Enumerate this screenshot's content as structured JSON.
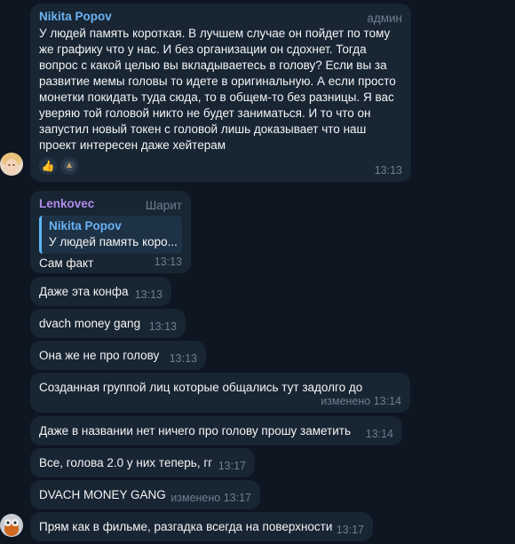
{
  "messages": [
    {
      "author": "Nikita Popov",
      "role": "админ",
      "text": "У людей память короткая. В лучшем случае он пойдет по тому\nже графику что у нас. И без организации он сдохнет. Тогда\nвопрос с какой целью вы вкладываетесь в  голову? Если вы за\nразвитие мемы головы то идете в оригинальную. А если просто\nмонетки покидать туда сюда, то в общем-то без разницы. Я вас\nуверяю той головой никто не будет заниматься. И то что он\nзапустил новый токен с головой лишь доказывает что наш\nпроект интересен даже хейтерам",
      "time": "13:13",
      "reactions": [
        "thumbs-up-emoji",
        "reaction-sticker"
      ]
    },
    {
      "author": "Lenkovec",
      "role": "Шарит",
      "reply": {
        "author": "Nikita Popov",
        "text": "У людей память коро..."
      },
      "text": "Сам факт",
      "time": "13:13"
    },
    {
      "text": "Даже эта конфа",
      "time": "13:13"
    },
    {
      "text": "dvach money gang",
      "time": "13:13"
    },
    {
      "text": "Она же не про голову",
      "time": "13:13"
    },
    {
      "text": "Созданная группой лиц которые общались тут задолго до",
      "time": "изменено 13:14"
    },
    {
      "text": "Даже в названии нет ничего про голову прошу заметить",
      "time": "13:14"
    },
    {
      "text": "Все, голова 2.0 у них теперь, гг",
      "time": "13:17"
    },
    {
      "text": "DVACH MONEY GANG",
      "time": "изменено 13:17"
    },
    {
      "text": "Прям как в фильме, разгадка всегда на поверхности",
      "time": "13:17"
    }
  ],
  "colors": {
    "background": "#0e1621",
    "bubble": "#182533",
    "author_nikita": "#6ab3f3",
    "author_lenkovec": "#b28ce8",
    "meta": "#6d7f8f"
  }
}
